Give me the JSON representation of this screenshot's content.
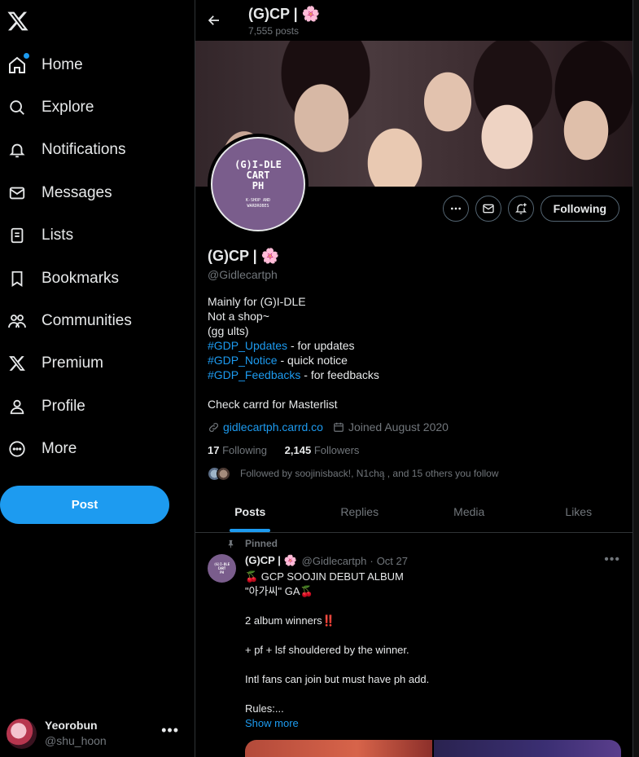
{
  "sidebar": {
    "items": [
      {
        "label": "Home"
      },
      {
        "label": "Explore"
      },
      {
        "label": "Notifications"
      },
      {
        "label": "Messages"
      },
      {
        "label": "Lists"
      },
      {
        "label": "Bookmarks"
      },
      {
        "label": "Communities"
      },
      {
        "label": "Premium"
      },
      {
        "label": "Profile"
      },
      {
        "label": "More"
      }
    ],
    "post_label": "Post",
    "account": {
      "name": "Yeorobun",
      "handle": "@shu_hoon"
    }
  },
  "header": {
    "name": "(G)CP | 🌸",
    "posts_count": "7,555 posts"
  },
  "avatar": {
    "line1": "(G)I-DLE",
    "line2": "CART",
    "line3": "PH",
    "sub1": "K-SHOP AND",
    "sub2": "WARDROBES"
  },
  "actions": {
    "following_label": "Following"
  },
  "profile": {
    "name": "(G)CP | 🌸",
    "handle": "@Gidlecartph",
    "bio": {
      "line1": "Mainly for (G)I-DLE",
      "line2": "Not a shop~",
      "line3": "(gg ults)",
      "tag1": "#GDP_Updates",
      "tag1_text": " - for updates",
      "tag2": "#GDP_Notice",
      "tag2_text": " - quick notice",
      "tag3": "#GDP_Feedbacks",
      "tag3_text": " - for feedbacks",
      "line4": "Check carrd for Masterlist"
    },
    "link": "gidlecartph.carrd.co",
    "joined": "Joined August 2020",
    "following_count": "17",
    "following_label": "Following",
    "followers_count": "2,145",
    "followers_label": "Followers",
    "followed_by": "Followed by soojinisback!, N1chaฺฺ , and 15 others you follow"
  },
  "tabs": [
    {
      "label": "Posts"
    },
    {
      "label": "Replies"
    },
    {
      "label": "Media"
    },
    {
      "label": "Likes"
    }
  ],
  "tweet": {
    "pinned_label": "Pinned",
    "name": "(G)CP | 🌸",
    "handle": "@Gidlecartph",
    "date": "Oct 27",
    "line1": "🍒 GCP SOOJIN DEBUT ALBUM",
    "line2": "\"아가씨\" GA🍒",
    "line3": "2 album winners‼️",
    "line4": "+ pf + lsf shouldered by the winner.",
    "line5": "Intl fans can join but must have ph add.",
    "line6": "Rules:...",
    "show_more": "Show more"
  },
  "colors": {
    "accent": "#1d9bf0",
    "background": "#000000",
    "text": "#e7e9ea",
    "muted": "#71767b"
  }
}
